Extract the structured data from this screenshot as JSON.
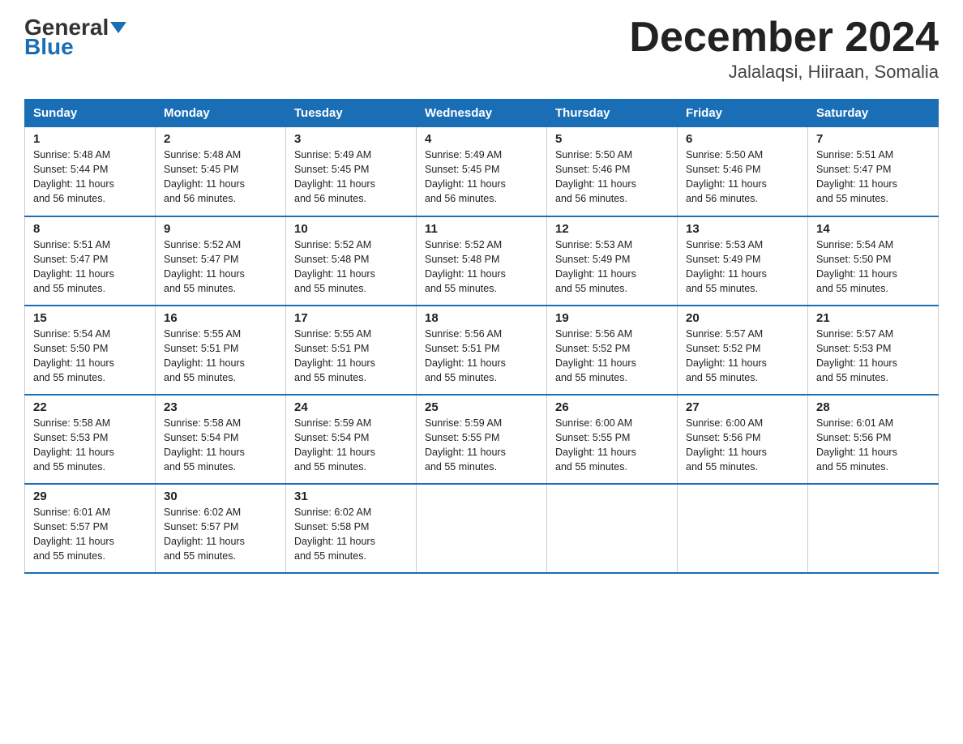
{
  "logo": {
    "general": "General",
    "blue": "Blue"
  },
  "header": {
    "month_year": "December 2024",
    "location": "Jalalaqsi, Hiiraan, Somalia"
  },
  "weekdays": [
    "Sunday",
    "Monday",
    "Tuesday",
    "Wednesday",
    "Thursday",
    "Friday",
    "Saturday"
  ],
  "weeks": [
    [
      {
        "day": "1",
        "sunrise": "5:48 AM",
        "sunset": "5:44 PM",
        "daylight": "11 hours and 56 minutes."
      },
      {
        "day": "2",
        "sunrise": "5:48 AM",
        "sunset": "5:45 PM",
        "daylight": "11 hours and 56 minutes."
      },
      {
        "day": "3",
        "sunrise": "5:49 AM",
        "sunset": "5:45 PM",
        "daylight": "11 hours and 56 minutes."
      },
      {
        "day": "4",
        "sunrise": "5:49 AM",
        "sunset": "5:45 PM",
        "daylight": "11 hours and 56 minutes."
      },
      {
        "day": "5",
        "sunrise": "5:50 AM",
        "sunset": "5:46 PM",
        "daylight": "11 hours and 56 minutes."
      },
      {
        "day": "6",
        "sunrise": "5:50 AM",
        "sunset": "5:46 PM",
        "daylight": "11 hours and 56 minutes."
      },
      {
        "day": "7",
        "sunrise": "5:51 AM",
        "sunset": "5:47 PM",
        "daylight": "11 hours and 55 minutes."
      }
    ],
    [
      {
        "day": "8",
        "sunrise": "5:51 AM",
        "sunset": "5:47 PM",
        "daylight": "11 hours and 55 minutes."
      },
      {
        "day": "9",
        "sunrise": "5:52 AM",
        "sunset": "5:47 PM",
        "daylight": "11 hours and 55 minutes."
      },
      {
        "day": "10",
        "sunrise": "5:52 AM",
        "sunset": "5:48 PM",
        "daylight": "11 hours and 55 minutes."
      },
      {
        "day": "11",
        "sunrise": "5:52 AM",
        "sunset": "5:48 PM",
        "daylight": "11 hours and 55 minutes."
      },
      {
        "day": "12",
        "sunrise": "5:53 AM",
        "sunset": "5:49 PM",
        "daylight": "11 hours and 55 minutes."
      },
      {
        "day": "13",
        "sunrise": "5:53 AM",
        "sunset": "5:49 PM",
        "daylight": "11 hours and 55 minutes."
      },
      {
        "day": "14",
        "sunrise": "5:54 AM",
        "sunset": "5:50 PM",
        "daylight": "11 hours and 55 minutes."
      }
    ],
    [
      {
        "day": "15",
        "sunrise": "5:54 AM",
        "sunset": "5:50 PM",
        "daylight": "11 hours and 55 minutes."
      },
      {
        "day": "16",
        "sunrise": "5:55 AM",
        "sunset": "5:51 PM",
        "daylight": "11 hours and 55 minutes."
      },
      {
        "day": "17",
        "sunrise": "5:55 AM",
        "sunset": "5:51 PM",
        "daylight": "11 hours and 55 minutes."
      },
      {
        "day": "18",
        "sunrise": "5:56 AM",
        "sunset": "5:51 PM",
        "daylight": "11 hours and 55 minutes."
      },
      {
        "day": "19",
        "sunrise": "5:56 AM",
        "sunset": "5:52 PM",
        "daylight": "11 hours and 55 minutes."
      },
      {
        "day": "20",
        "sunrise": "5:57 AM",
        "sunset": "5:52 PM",
        "daylight": "11 hours and 55 minutes."
      },
      {
        "day": "21",
        "sunrise": "5:57 AM",
        "sunset": "5:53 PM",
        "daylight": "11 hours and 55 minutes."
      }
    ],
    [
      {
        "day": "22",
        "sunrise": "5:58 AM",
        "sunset": "5:53 PM",
        "daylight": "11 hours and 55 minutes."
      },
      {
        "day": "23",
        "sunrise": "5:58 AM",
        "sunset": "5:54 PM",
        "daylight": "11 hours and 55 minutes."
      },
      {
        "day": "24",
        "sunrise": "5:59 AM",
        "sunset": "5:54 PM",
        "daylight": "11 hours and 55 minutes."
      },
      {
        "day": "25",
        "sunrise": "5:59 AM",
        "sunset": "5:55 PM",
        "daylight": "11 hours and 55 minutes."
      },
      {
        "day": "26",
        "sunrise": "6:00 AM",
        "sunset": "5:55 PM",
        "daylight": "11 hours and 55 minutes."
      },
      {
        "day": "27",
        "sunrise": "6:00 AM",
        "sunset": "5:56 PM",
        "daylight": "11 hours and 55 minutes."
      },
      {
        "day": "28",
        "sunrise": "6:01 AM",
        "sunset": "5:56 PM",
        "daylight": "11 hours and 55 minutes."
      }
    ],
    [
      {
        "day": "29",
        "sunrise": "6:01 AM",
        "sunset": "5:57 PM",
        "daylight": "11 hours and 55 minutes."
      },
      {
        "day": "30",
        "sunrise": "6:02 AM",
        "sunset": "5:57 PM",
        "daylight": "11 hours and 55 minutes."
      },
      {
        "day": "31",
        "sunrise": "6:02 AM",
        "sunset": "5:58 PM",
        "daylight": "11 hours and 55 minutes."
      },
      null,
      null,
      null,
      null
    ]
  ],
  "labels": {
    "sunrise": "Sunrise:",
    "sunset": "Sunset:",
    "daylight": "Daylight:"
  }
}
